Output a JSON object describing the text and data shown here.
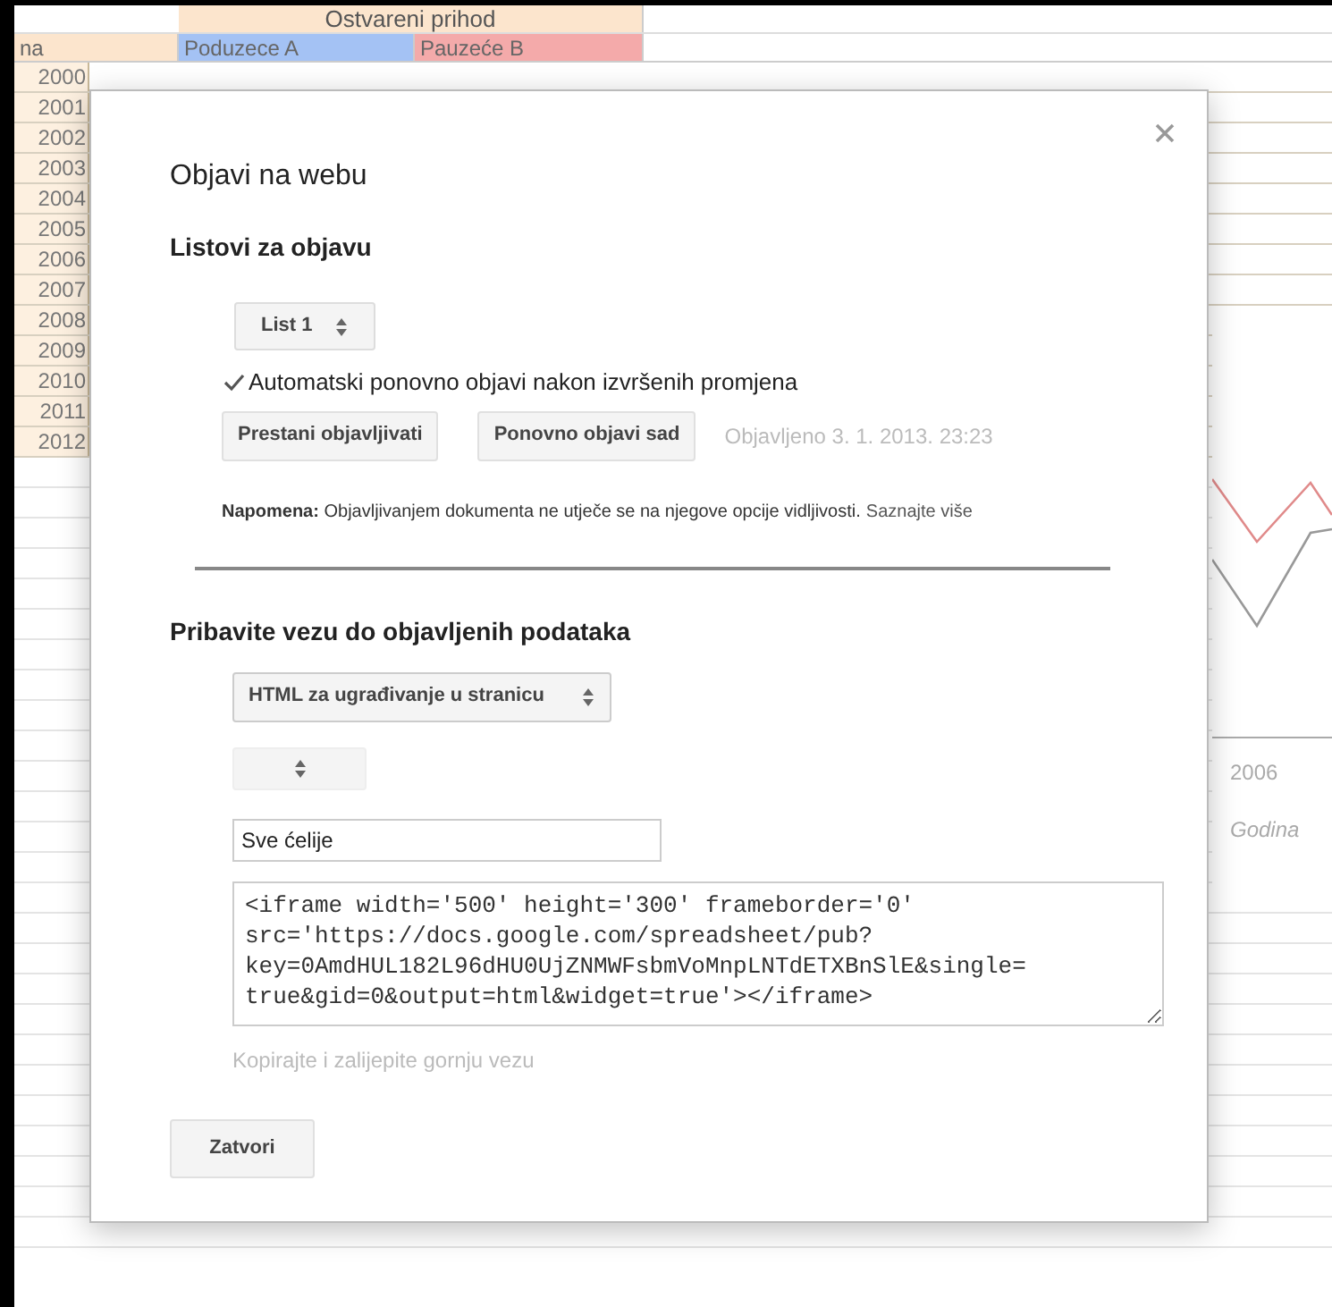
{
  "spreadsheet": {
    "group_header": "Ostvareni prihod",
    "columns": [
      {
        "label": "na",
        "color": "#fce5cd"
      },
      {
        "label": "Poduzece A",
        "color": "#a4c2f4"
      },
      {
        "label": "Pauzeće B",
        "color": "#f4aaaa"
      }
    ],
    "rows": [
      "2000",
      "2001",
      "2002",
      "2003",
      "2004",
      "2005",
      "2006",
      "2007",
      "2008",
      "2009",
      "2010",
      "2011",
      "2012"
    ]
  },
  "chart": {
    "x_tick": "2006",
    "x_axis_title": "Godina"
  },
  "dialog": {
    "title": "Objavi na webu",
    "sheets_section": {
      "heading": "Listovi za objavu",
      "sheet_select": "List 1",
      "auto_republish": {
        "label": "Automatski ponovno objavi nakon izvršenih promjena",
        "checked": true
      },
      "buttons": [
        "Prestani objavljivati",
        "Ponovno objavi sad"
      ],
      "published_status": "Objavljeno 3. 1. 2013. 23:23",
      "note": "**Napomena:** Objavljivanjem dokumenta ne utječe se na njegove opcije vidljivosti.",
      "note_link": "Saznajte više"
    },
    "link_section": {
      "heading": "Pribavite vezu do objavljenih podataka",
      "format_select": "HTML za ugrađivanje u stranicu",
      "range_field": "Sve ćelije",
      "embed_code": "<iframe width='500' height='300' frameborder='0'\nsrc='https://docs.google.com/spreadsheet/pub?\nkey=0AmdHUL182L96dHU0UjZNMWFsbmVoMnpLNTdETXBnSlE&single=\ntrue&gid=0&output=html&widget=true'></iframe>",
      "hint": "Kopirajte i zalijepite gornju vezu"
    },
    "close_button": "Zatvori"
  }
}
